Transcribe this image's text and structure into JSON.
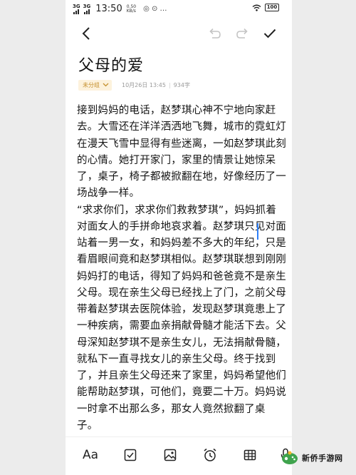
{
  "status_bar": {
    "network_1": "3G",
    "network_2": "3G",
    "time": "13:50",
    "speed_value": "0.50",
    "speed_unit": "KB/s",
    "misc": "◎ ⊙ …",
    "battery": "100"
  },
  "toolbar": {
    "back_icon": "chevron-left",
    "undo_icon": "undo-arrow",
    "redo_icon": "redo-arrow",
    "done_icon": "checkmark"
  },
  "note": {
    "title": "父母的爱",
    "category": "未分组",
    "date": "10月26日 13:45",
    "char_count": "934字",
    "lines": [
      "接到妈妈的电话，赵梦琪心神不宁地向家赶",
      "去。大雪还在洋洋洒洒地飞舞，城市的霓虹灯",
      "在漫天飞雪中显得有些迷离，一如赵梦琪此刻",
      "的心情。她打开家门，家里的情景让她惊呆",
      "了，桌子，椅子都被掀翻在地，好像经历了一",
      "场战争一样。",
      "“求求你们，求求你们救救梦琪”，妈妈抓着",
      "对面女人的手拼命地哀求着。赵梦琪只见对面",
      "站着一男一女，和妈妈差不多大的年纪，只是",
      "看眉眼间竟和赵梦琪相似。赵梦琪联想到刚刚",
      "妈妈打的电话，得知了妈妈和爸爸竟不是亲生",
      "父母。现在亲生父母已经找上了门，之前父母",
      "带着赵梦琪去医院体验，发现赵梦琪竟患上了",
      "一种疾病，需要血亲捐献骨髓才能活下去。父",
      "母深知赵梦琪不是亲生女儿，无法捐献骨髓，",
      "就私下一直寻找女儿的亲生父母。终于找到",
      "了，并且亲生父母还来了家里，妈妈希望他们",
      "能帮助赵梦琪，可他们，竟要二十万。妈妈说",
      "一时拿不出那么多，那女人竟然掀翻了桌",
      "子。"
    ]
  },
  "bottom_bar": {
    "text_format_label": "Aa",
    "checklist_icon": "checkbox",
    "image_icon": "image",
    "alarm_icon": "alarm-clock",
    "table_icon": "table-grid",
    "voice_icon": "microphone"
  },
  "watermark": {
    "text": "新侨手游网"
  }
}
